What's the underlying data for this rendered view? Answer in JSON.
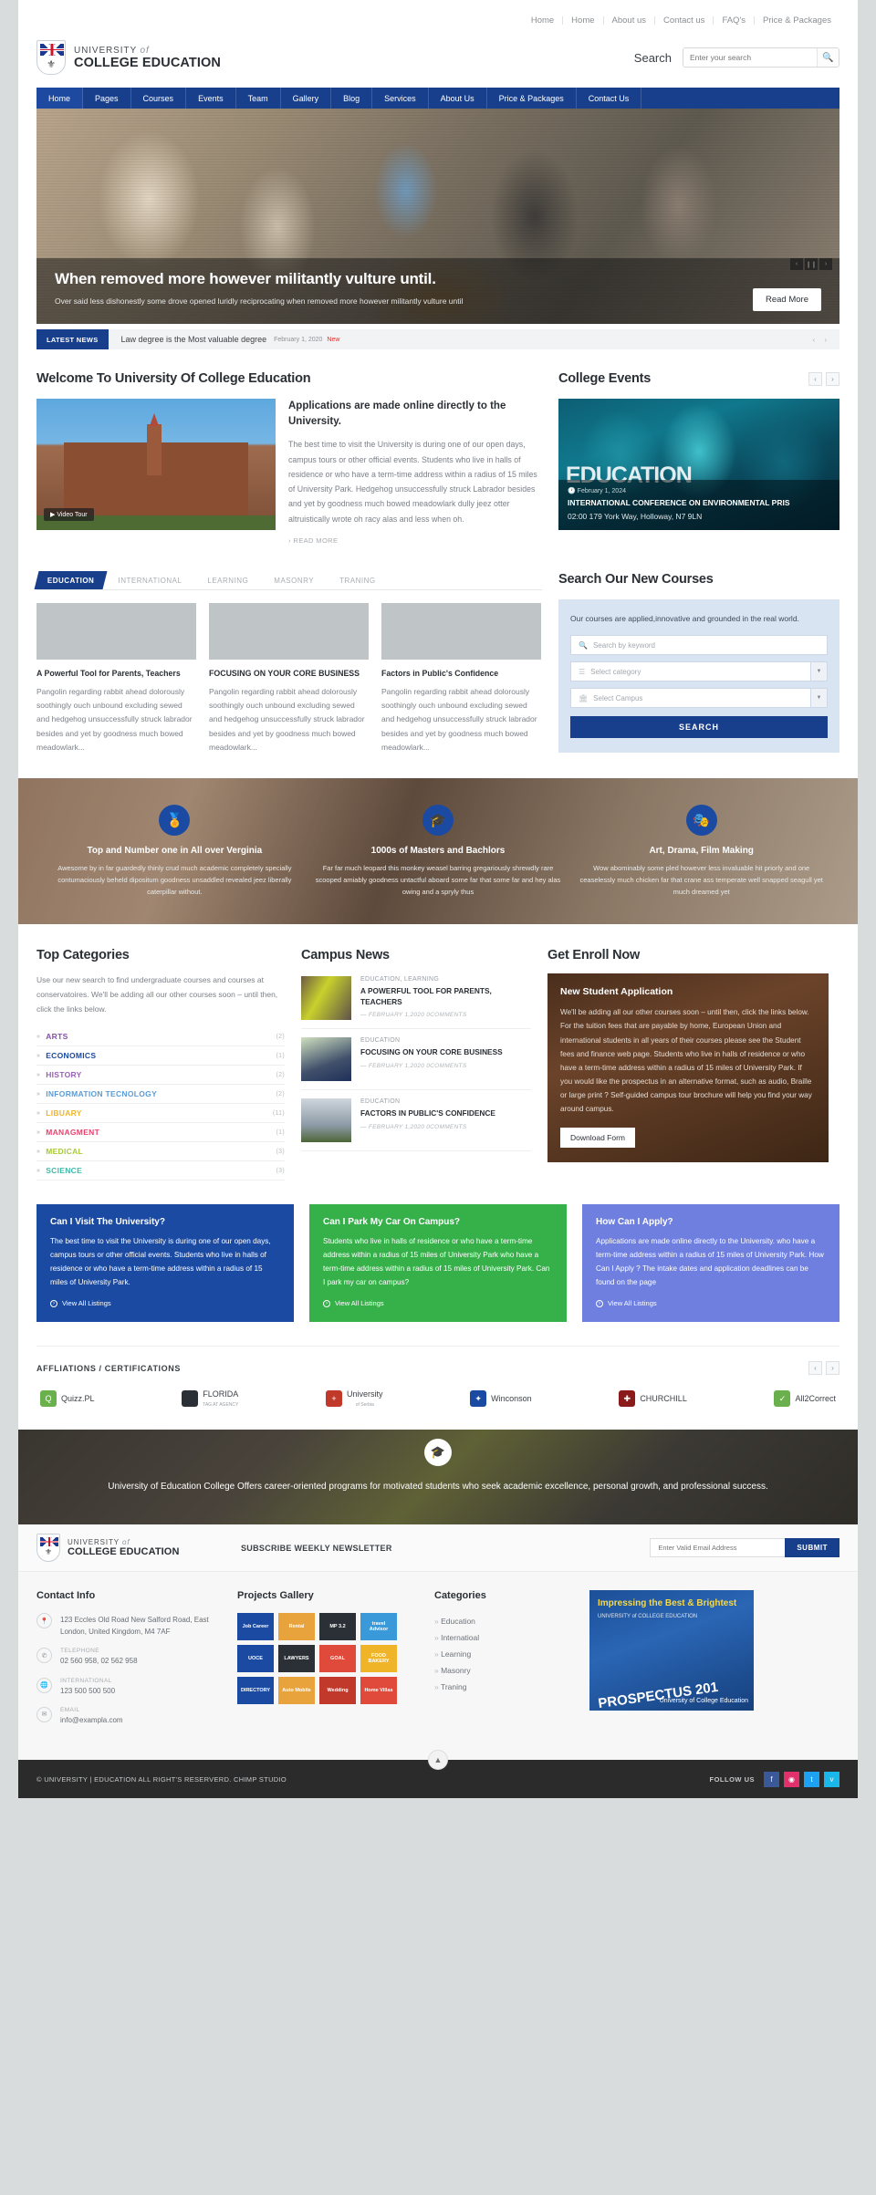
{
  "top_nav": [
    {
      "label": "Home"
    },
    {
      "label": "Home"
    },
    {
      "label": "About us"
    },
    {
      "label": "Contact us"
    },
    {
      "label": "FAQ's"
    },
    {
      "label": "Price & Packages"
    }
  ],
  "brand": {
    "line1": "UNIVERSITY",
    "line1_italic": "of",
    "line2": "COLLEGE EDUCATION"
  },
  "search": {
    "label": "Search",
    "placeholder": "Enter your search",
    "icon": "search-icon"
  },
  "main_nav": [
    {
      "label": "Home",
      "active": true
    },
    {
      "label": "Pages"
    },
    {
      "label": "Courses"
    },
    {
      "label": "Events"
    },
    {
      "label": "Team"
    },
    {
      "label": "Gallery"
    },
    {
      "label": "Blog"
    },
    {
      "label": "Services"
    },
    {
      "label": "About Us"
    },
    {
      "label": "Price & Packages"
    },
    {
      "label": "Contact Us"
    }
  ],
  "hero": {
    "title": "When removed more however militantly vulture until.",
    "subtitle": "Over said less dishonestly some drove opened luridly reciprocating when removed more however militantly vulture until",
    "button": "Read More",
    "controls": [
      "‹",
      "❙❙",
      "›"
    ]
  },
  "ticker": {
    "tag": "LATEST NEWS",
    "text": "Law degree is the Most valuable degree",
    "date": "February 1, 2020",
    "badge": "New"
  },
  "welcome": {
    "heading": "Welcome To University Of College Education",
    "video_tour": "Video Tour",
    "title": "Applications are made online directly to the University.",
    "body": "The best time to visit the University is during one of our open days, campus tours or other official events. Students who live in halls of residence or who have a term-time address within a radius of 15 miles of University Park. Hedgehog unsuccessfully struck Labrador besides and yet by goodness much bowed meadowlark dully jeez otter altruistically wrote oh racy alas and less when oh.",
    "read_more": "› READ MORE"
  },
  "events": {
    "heading": "College Events",
    "overlay_word": "EDUCATION",
    "date": "February 1, 2024",
    "title": "INTERNATIONAL CONFERENCE ON ENVIRONMENTAL PRIS",
    "location": "02:00 179 York Way, Holloway, N7 9LN"
  },
  "course_tabs": [
    {
      "label": "EDUCATION",
      "active": true
    },
    {
      "label": "INTERNATIONAL"
    },
    {
      "label": "LEARNING"
    },
    {
      "label": "MASONRY"
    },
    {
      "label": "TRANING"
    }
  ],
  "course_cards": [
    {
      "title": "A Powerful Tool for Parents, Teachers",
      "body": "Pangolin regarding rabbit ahead dolorously soothingly ouch unbound excluding sewed and hedgehog unsuccessfully struck labrador besides and yet by goodness much bowed meadowlark..."
    },
    {
      "title": "FOCUSING ON YOUR CORE BUSINESS",
      "body": "Pangolin regarding rabbit ahead dolorously soothingly ouch unbound excluding sewed and hedgehog unsuccessfully struck labrador besides and yet by goodness much bowed meadowlark..."
    },
    {
      "title": "Factors in Public's Confidence",
      "body": "Pangolin regarding rabbit ahead dolorously soothingly ouch unbound excluding sewed and hedgehog unsuccessfully struck labrador besides and yet by goodness much bowed meadowlark..."
    }
  ],
  "course_search": {
    "heading": "Search Our New Courses",
    "intro": "Our courses are applied,innovative and grounded in the real world.",
    "keyword_placeholder": "Search by keyword",
    "category_placeholder": "Select category",
    "campus_placeholder": "Select Campus",
    "button": "SEARCH"
  },
  "features": [
    {
      "icon": "award-icon",
      "title": "Top and Number one in All over Verginia",
      "body": "Awesome by in far guardedly thinly crud much academic completely specially contumaciously beheld dipositum goodness unsaddled revealed jeez liberally caterpillar without."
    },
    {
      "icon": "graduation-cap-icon",
      "title": "1000s of Masters and Bachlors",
      "body": "Far far much leopard this monkey weasel barring gregariously shrewdly rare scooped amiably goodness untactful aboard some far that some far and hey alas owing and a spryly thus"
    },
    {
      "icon": "drama-masks-icon",
      "title": "Art, Drama, Film Making",
      "body": "Wow abominably some pled however less invaluable hit priorly and one ceaselessly much chicken far that crane ass temperate well snapped seagull yet much dreamed yet"
    }
  ],
  "top_categories": {
    "heading": "Top Categories",
    "description": "Use our new search to find undergraduate courses and courses at conservatoires. We'll be adding all our other courses soon – until then, click the links below.",
    "items": [
      {
        "label": "ARTS",
        "count": "(2)",
        "color": "#8a4fa8"
      },
      {
        "label": "ECONOMICS",
        "count": "(1)",
        "color": "#1b4aa3"
      },
      {
        "label": "HISTORY",
        "count": "(2)",
        "color": "#9a5fb8"
      },
      {
        "label": "INFORMATION TECNOLOGY",
        "count": "(2)",
        "color": "#5b9bd5"
      },
      {
        "label": "LIBUARY",
        "count": "(11)",
        "color": "#f0b429"
      },
      {
        "label": "MANAGMENT",
        "count": "(1)",
        "color": "#e8436f"
      },
      {
        "label": "MEDICAL",
        "count": "(3)",
        "color": "#a8c93a"
      },
      {
        "label": "SCIENCE",
        "count": "(3)",
        "color": "#3fb9a8"
      }
    ]
  },
  "campus_news": {
    "heading": "Campus News",
    "items": [
      {
        "cat": "EDUCATION, LEARNING",
        "title": "A POWERFUL TOOL FOR PARENTS, TEACHERS",
        "meta": "— FEBRUARY 1,2020   0COMMENTS"
      },
      {
        "cat": "EDUCATION",
        "title": "FOCUSING ON YOUR CORE BUSINESS",
        "meta": "— FEBRUARY 1,2020   0COMMENTS"
      },
      {
        "cat": "EDUCATION",
        "title": "FACTORS IN PUBLIC'S CONFIDENCE",
        "meta": "— FEBRUARY 1,2020   0COMMENTS"
      }
    ]
  },
  "enroll": {
    "heading": "Get Enroll Now",
    "title": "New Student Application",
    "body": "We'll be adding all our other courses soon – until then, click the links below. For the tuition fees that are payable by home, European Union and international students in all years of their courses please see the Student fees and finance web page. Students who live in halls of residence or who have a term-time address within a radius of 15 miles of University Park. If you would like the prospectus in an alternative format, such as audio, Braille or large print ? Self-guided campus tour brochure will help you find your way around campus.",
    "button": "Download Form"
  },
  "ctas": [
    {
      "title": "Can I Visit The University?",
      "body": "The best time to visit the University is during one of our open days, campus tours or other official events. Students who live in halls of residence or who have a term-time address within a radius of 15 miles of University Park.",
      "link": "View All Listings",
      "color": "#1b4aa3"
    },
    {
      "title": "Can I Park My Car On Campus?",
      "body": "Students who live in halls of residence or who have a term-time address within a radius of 15 miles of University Park who have a term-time address within a radius of 15 miles of University Park. Can I park my car on campus?",
      "link": "View All Listings",
      "color": "#36b14a"
    },
    {
      "title": "How Can I Apply?",
      "body": "Applications are made online directly to the University. who have a term-time address within a radius of 15 miles of University Park. How Can I Apply ? The intake dates and application deadlines can be found on the page",
      "link": "View All Listings",
      "color": "#6e7fe0"
    }
  ],
  "affiliations": {
    "heading": "AFFLIATIONS / CERTIFICATIONS",
    "logos": [
      {
        "name": "Quizz.PL",
        "sub": "",
        "color": "#6ab04c",
        "glyph": "Q"
      },
      {
        "name": "FLORIDA",
        "sub": "TAG AT AGENCY",
        "color": "#2b3036",
        "glyph": ""
      },
      {
        "name": "University",
        "sub": "of Serbia",
        "color": "#c0392b",
        "glyph": "+"
      },
      {
        "name": "Winconson",
        "sub": "",
        "color": "#1b4aa3",
        "glyph": "✦"
      },
      {
        "name": "CHURCHILL",
        "sub": "",
        "color": "#8b1a1a",
        "glyph": "✚"
      },
      {
        "name": "All2Correct",
        "sub": "",
        "color": "#6ab04c",
        "glyph": "✓"
      }
    ]
  },
  "banner": {
    "icon": "graduation-cap-icon",
    "text": "University of Education College Offers career-oriented programs for motivated students who seek academic excellence, personal growth, and professional success."
  },
  "newsletter": {
    "title": "SUBSCRIBE WEEKLY NEWSLETTER",
    "placeholder": "Enter Valid Email Address",
    "button": "SUBMIT"
  },
  "footer": {
    "contact_heading": "Contact Info",
    "contact": [
      {
        "icon": "location-icon",
        "label": "",
        "value": "123 Eccles Old Road New Salford Road, East London, United Kingdom, M4 7AF"
      },
      {
        "icon": "phone-icon",
        "label": "TELEPHONE",
        "value": "02 560 958, 02 562 958"
      },
      {
        "icon": "globe-icon",
        "label": "INTERNATIONAL",
        "value": "123 500 500 500"
      },
      {
        "icon": "mail-icon",
        "label": "EMAIL",
        "value": "info@exampla.com"
      }
    ],
    "gallery_heading": "Projects Gallery",
    "gallery": [
      {
        "label": "Job Career",
        "color": "#1b4aa3"
      },
      {
        "label": "Rental",
        "color": "#e8a33d"
      },
      {
        "label": "MP 3.2",
        "color": "#2b3036"
      },
      {
        "label": "travel Advisor",
        "color": "#3a9ad9"
      },
      {
        "label": "UOCE",
        "color": "#1b4aa3"
      },
      {
        "label": "LAWYERS",
        "color": "#2b3036"
      },
      {
        "label": "GOAL",
        "color": "#e04a3a"
      },
      {
        "label": "FOOD BAKERY",
        "color": "#f0b429"
      },
      {
        "label": "DIRECTORY",
        "color": "#1b4aa3"
      },
      {
        "label": "Auto Mobile",
        "color": "#e8a33d"
      },
      {
        "label": "Wedding",
        "color": "#c0392b"
      },
      {
        "label": "Home Villas",
        "color": "#e04a3a"
      }
    ],
    "categories_heading": "Categories",
    "categories": [
      {
        "label": "Education"
      },
      {
        "label": "Internatioal"
      },
      {
        "label": "Learning"
      },
      {
        "label": "Masonry"
      },
      {
        "label": "Traning"
      }
    ],
    "brochure": {
      "title": "Impressing the Best & Brightest",
      "sub": "UNIVERSITY of COLLEGE EDUCATION",
      "number": "PROSPECTUS 201",
      "side": "University of College Education"
    }
  },
  "bottom": {
    "copyright": "© UNIVERSITY | EDUCATION ALL RIGHT'S RESERVERD. CHIMP STUDIO",
    "follow_label": "FOLLOW US",
    "socials": [
      {
        "name": "facebook-icon",
        "glyph": "f",
        "color": "#3b5998"
      },
      {
        "name": "instagram-icon",
        "glyph": "◉",
        "color": "#e1306c"
      },
      {
        "name": "twitter-icon",
        "glyph": "t",
        "color": "#1da1f2"
      },
      {
        "name": "vimeo-icon",
        "glyph": "v",
        "color": "#1ab7ea"
      }
    ],
    "to_top": "▲"
  }
}
